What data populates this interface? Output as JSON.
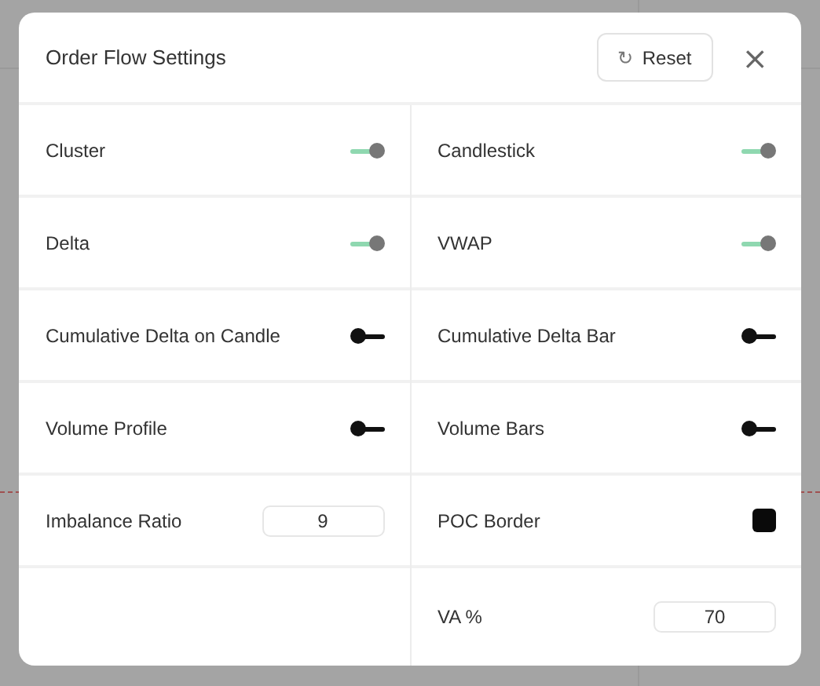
{
  "dialog": {
    "title": "Order Flow Settings",
    "reset_button": {
      "icon": "↻",
      "label": "Reset"
    },
    "close_button": "×"
  },
  "columns": [
    {
      "settings": [
        {
          "kind": "toggle",
          "label": "Cluster",
          "on": true
        },
        {
          "kind": "toggle",
          "label": "Delta",
          "on": true
        },
        {
          "kind": "toggle",
          "label": "Cumulative Delta on Candle",
          "on": false
        },
        {
          "kind": "toggle",
          "label": "Volume Profile",
          "on": false
        },
        {
          "kind": "number",
          "label": "Imbalance Ratio",
          "value": "9"
        }
      ]
    },
    {
      "settings": [
        {
          "kind": "toggle",
          "label": "Candlestick",
          "on": true
        },
        {
          "kind": "toggle",
          "label": "VWAP",
          "on": true
        },
        {
          "kind": "toggle",
          "label": "Cumulative Delta Bar",
          "on": false
        },
        {
          "kind": "toggle",
          "label": "Volume Bars",
          "on": false
        },
        {
          "kind": "color",
          "label": "POC Border",
          "color": "#0a0a0a"
        },
        {
          "kind": "number",
          "label": "VA %",
          "value": "70"
        }
      ]
    }
  ]
}
